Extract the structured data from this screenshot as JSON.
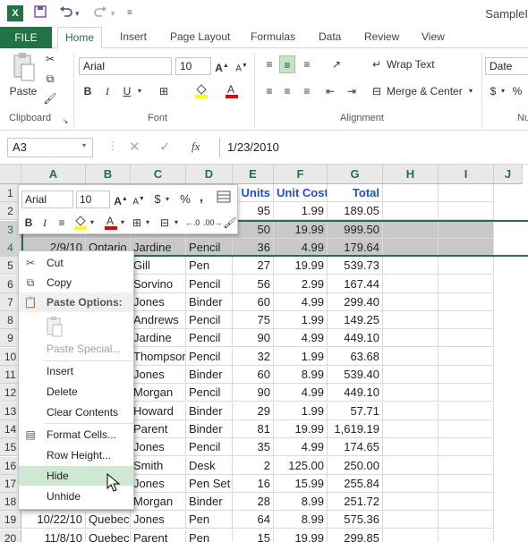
{
  "titlebar": {
    "logo": "X",
    "title": "SampleI",
    "qat": [
      "save-icon",
      "undo-icon",
      "redo-icon",
      "customize-icon"
    ]
  },
  "tabs": {
    "file": "FILE",
    "items": [
      "Home",
      "Insert",
      "Page Layout",
      "Formulas",
      "Data",
      "Review",
      "View"
    ],
    "active": "Home"
  },
  "ribbon": {
    "paste_label": "Paste",
    "font_name": "Arial",
    "font_size": "10",
    "number_format": "Date",
    "wrap_text": "Wrap Text",
    "merge_center": "Merge & Center",
    "groups": {
      "clipboard": "Clipboard",
      "font": "Font",
      "alignment": "Alignment",
      "number": "Nu"
    },
    "bold": "B",
    "italic": "I",
    "underline": "U",
    "currency": "$",
    "percent": "%"
  },
  "formula_bar": {
    "name_box": "A3",
    "fx": "fx",
    "value": "1/23/2010"
  },
  "columns": [
    "A",
    "B",
    "C",
    "D",
    "E",
    "F",
    "G",
    "H",
    "I",
    "J"
  ],
  "rows": [
    {
      "n": "1",
      "cells": [
        "",
        "",
        "",
        "",
        "Units",
        "Unit Cost",
        "Total"
      ]
    },
    {
      "n": "2",
      "cells": [
        "",
        "",
        "",
        "",
        "95",
        "1.99",
        "189.05"
      ]
    },
    {
      "n": "3",
      "cells": [
        "",
        "",
        "",
        "",
        "50",
        "19.99",
        "999.50"
      ]
    },
    {
      "n": "4",
      "cells": [
        "2/9/10",
        "Ontario",
        "Jardine",
        "Pencil",
        "36",
        "4.99",
        "179.64"
      ]
    },
    {
      "n": "5",
      "cells": [
        "",
        "",
        "Gill",
        "Pen",
        "27",
        "19.99",
        "539.73"
      ]
    },
    {
      "n": "6",
      "cells": [
        "",
        "",
        "Sorvino",
        "Pencil",
        "56",
        "2.99",
        "167.44"
      ]
    },
    {
      "n": "7",
      "cells": [
        "",
        "",
        "Jones",
        "Binder",
        "60",
        "4.99",
        "299.40"
      ]
    },
    {
      "n": "8",
      "cells": [
        "",
        "",
        "Andrews",
        "Pencil",
        "75",
        "1.99",
        "149.25"
      ]
    },
    {
      "n": "9",
      "cells": [
        "",
        "",
        "Jardine",
        "Pencil",
        "90",
        "4.99",
        "449.10"
      ]
    },
    {
      "n": "10",
      "cells": [
        "",
        "",
        "Thompson",
        "Pencil",
        "32",
        "1.99",
        "63.68"
      ]
    },
    {
      "n": "11",
      "cells": [
        "",
        "",
        "Jones",
        "Binder",
        "60",
        "8.99",
        "539.40"
      ]
    },
    {
      "n": "12",
      "cells": [
        "",
        "",
        "Morgan",
        "Pencil",
        "90",
        "4.99",
        "449.10"
      ]
    },
    {
      "n": "13",
      "cells": [
        "",
        "",
        "Howard",
        "Binder",
        "29",
        "1.99",
        "57.71"
      ]
    },
    {
      "n": "14",
      "cells": [
        "",
        "",
        "Parent",
        "Binder",
        "81",
        "19.99",
        "1,619.19"
      ]
    },
    {
      "n": "15",
      "cells": [
        "",
        "",
        "Jones",
        "Pencil",
        "35",
        "4.99",
        "174.65"
      ]
    },
    {
      "n": "16",
      "cells": [
        "",
        "",
        "Smith",
        "Desk",
        "2",
        "125.00",
        "250.00"
      ]
    },
    {
      "n": "17",
      "cells": [
        "",
        "",
        "Jones",
        "Pen Set",
        "16",
        "15.99",
        "255.84"
      ]
    },
    {
      "n": "18",
      "cells": [
        "",
        "",
        "Morgan",
        "Binder",
        "28",
        "8.99",
        "251.72"
      ]
    },
    {
      "n": "19",
      "cells": [
        "10/22/10",
        "Quebec",
        "Jones",
        "Pen",
        "64",
        "8.99",
        "575.36"
      ]
    },
    {
      "n": "20",
      "cells": [
        "11/8/10",
        "Quebec",
        "Parent",
        "Pen",
        "15",
        "19.99",
        "299.85"
      ]
    }
  ],
  "mini_toolbar": {
    "font_name": "Arial",
    "font_size": "10",
    "currency": "$",
    "percent": "%",
    "comma": ",",
    "bold": "B",
    "italic": "I"
  },
  "context_menu": {
    "cut": "Cut",
    "copy": "Copy",
    "paste_options": "Paste Options:",
    "paste_special": "Paste Special...",
    "insert": "Insert",
    "delete": "Delete",
    "clear_contents": "Clear Contents",
    "format_cells": "Format Cells...",
    "row_height": "Row Height...",
    "hide": "Hide",
    "unhide": "Unhide"
  },
  "colors": {
    "accent": "#217346",
    "header_text": "#1f4fd1",
    "selection": "#c8c8c8",
    "hover": "#cfe8d3"
  }
}
